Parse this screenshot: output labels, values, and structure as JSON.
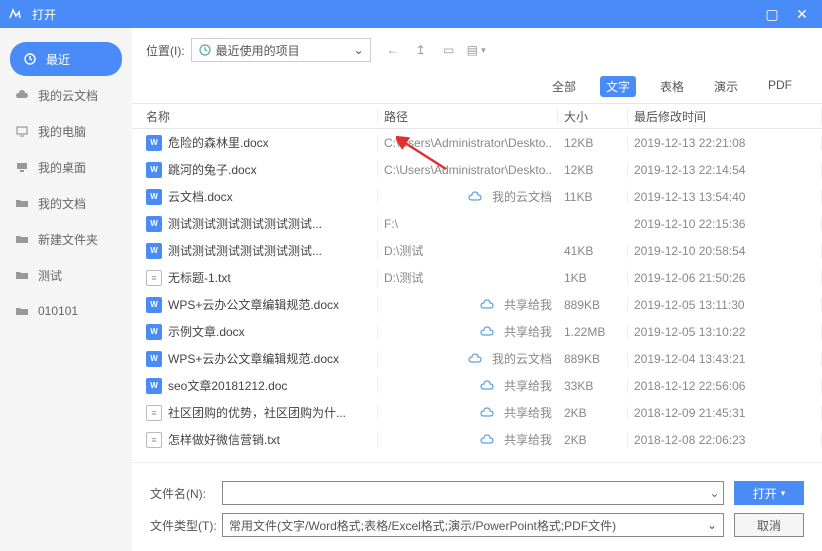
{
  "title": "打开",
  "sidebar": [
    {
      "label": "最近",
      "icon": "clock"
    },
    {
      "label": "我的云文档",
      "icon": "cloud"
    },
    {
      "label": "我的电脑",
      "icon": "computer"
    },
    {
      "label": "我的桌面",
      "icon": "desktop"
    },
    {
      "label": "我的文档",
      "icon": "folder"
    },
    {
      "label": "新建文件夹",
      "icon": "folder"
    },
    {
      "label": "测试",
      "icon": "folder"
    },
    {
      "label": "010101",
      "icon": "folder"
    }
  ],
  "toolbar": {
    "loc_label": "位置(I):",
    "loc_value": "最近使用的项目"
  },
  "tabs": [
    "全部",
    "文字",
    "表格",
    "演示",
    "PDF"
  ],
  "active_tab": 1,
  "active_sidebar": 0,
  "cols": {
    "name": "名称",
    "path": "路径",
    "size": "大小",
    "date": "最后修改时间"
  },
  "files": [
    {
      "name": "危险的森林里.docx",
      "path": "C:\\Users\\Administrator\\Deskto...",
      "size": "12KB",
      "date": "2019-12-13 22:21:08",
      "type": "w",
      "cloud": false
    },
    {
      "name": "跳河的兔子.docx",
      "path": "C:\\Users\\Administrator\\Deskto...",
      "size": "12KB",
      "date": "2019-12-13 22:14:54",
      "type": "w",
      "cloud": false
    },
    {
      "name": "云文档.docx",
      "path": "我的云文档",
      "size": "11KB",
      "date": "2019-12-13 13:54:40",
      "type": "w",
      "cloud": true
    },
    {
      "name": "测试测试测试测试测试测试...",
      "path": "F:\\",
      "size": "",
      "date": "2019-12-10 22:15:36",
      "type": "w",
      "cloud": false
    },
    {
      "name": "测试测试测试测试测试测试...",
      "path": "D:\\测试",
      "size": "41KB",
      "date": "2019-12-10 20:58:54",
      "type": "w",
      "cloud": false
    },
    {
      "name": "无标题-1.txt",
      "path": "D:\\测试",
      "size": "1KB",
      "date": "2019-12-06 21:50:26",
      "type": "t",
      "cloud": false
    },
    {
      "name": "WPS+云办公文章编辑规范.docx",
      "path": "共享给我",
      "size": "889KB",
      "date": "2019-12-05 13:11:30",
      "type": "w",
      "cloud": true
    },
    {
      "name": "示例文章.docx",
      "path": "共享给我",
      "size": "1.22MB",
      "date": "2019-12-05 13:10:22",
      "type": "w",
      "cloud": true
    },
    {
      "name": "WPS+云办公文章编辑规范.docx",
      "path": "我的云文档",
      "size": "889KB",
      "date": "2019-12-04 13:43:21",
      "type": "w",
      "cloud": true
    },
    {
      "name": "seo文章20181212.doc",
      "path": "共享给我",
      "size": "33KB",
      "date": "2018-12-12 22:56:06",
      "type": "w",
      "cloud": true
    },
    {
      "name": "社区团购的优势，社区团购为什...",
      "path": "共享给我",
      "size": "2KB",
      "date": "2018-12-09 21:45:31",
      "type": "t",
      "cloud": true
    },
    {
      "name": "怎样做好微信营销.txt",
      "path": "共享给我",
      "size": "2KB",
      "date": "2018-12-08 22:06:23",
      "type": "t",
      "cloud": true
    }
  ],
  "footer": {
    "fname_label": "文件名(N):",
    "ftype_label": "文件类型(T):",
    "ftype_value": "常用文件(文字/Word格式;表格/Excel格式;演示/PowerPoint格式;PDF文件)",
    "open": "打开",
    "cancel": "取消"
  }
}
